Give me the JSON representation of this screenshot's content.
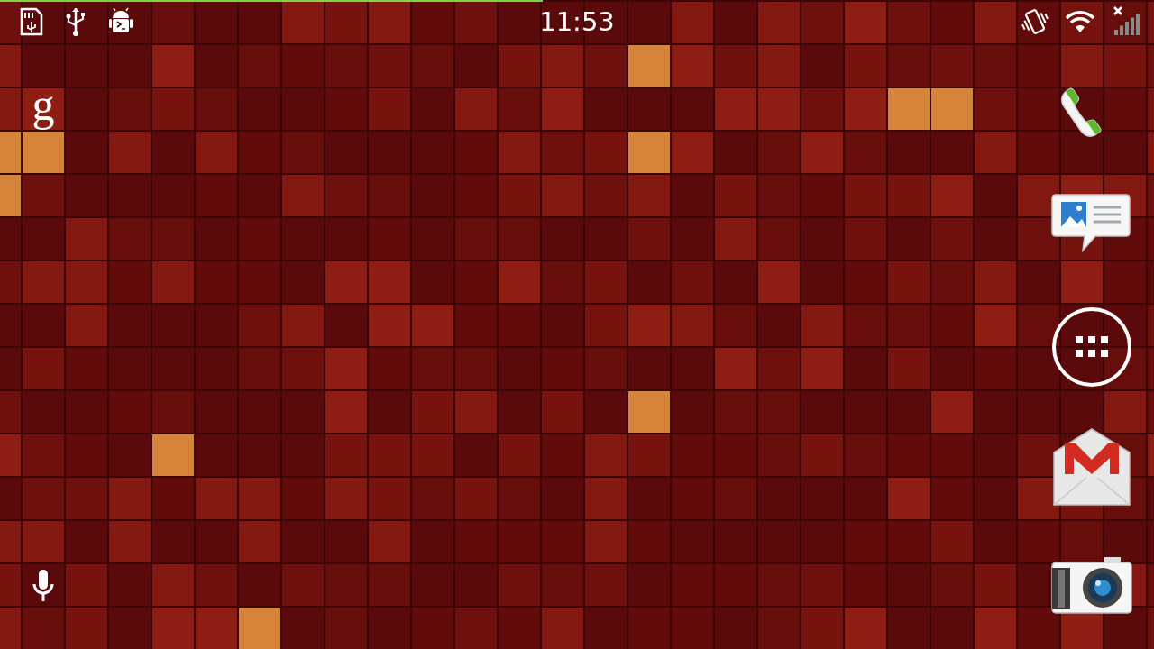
{
  "status_bar": {
    "time": "11:53",
    "wifi_connected": true,
    "signal_level": 0
  },
  "progress": {
    "level": 0.47
  },
  "search": {
    "label": "g"
  },
  "dock": {
    "items": [
      {
        "kind": "phone"
      },
      {
        "kind": "messaging"
      },
      {
        "kind": "apps"
      },
      {
        "kind": "gmail"
      },
      {
        "kind": "camera"
      }
    ]
  }
}
